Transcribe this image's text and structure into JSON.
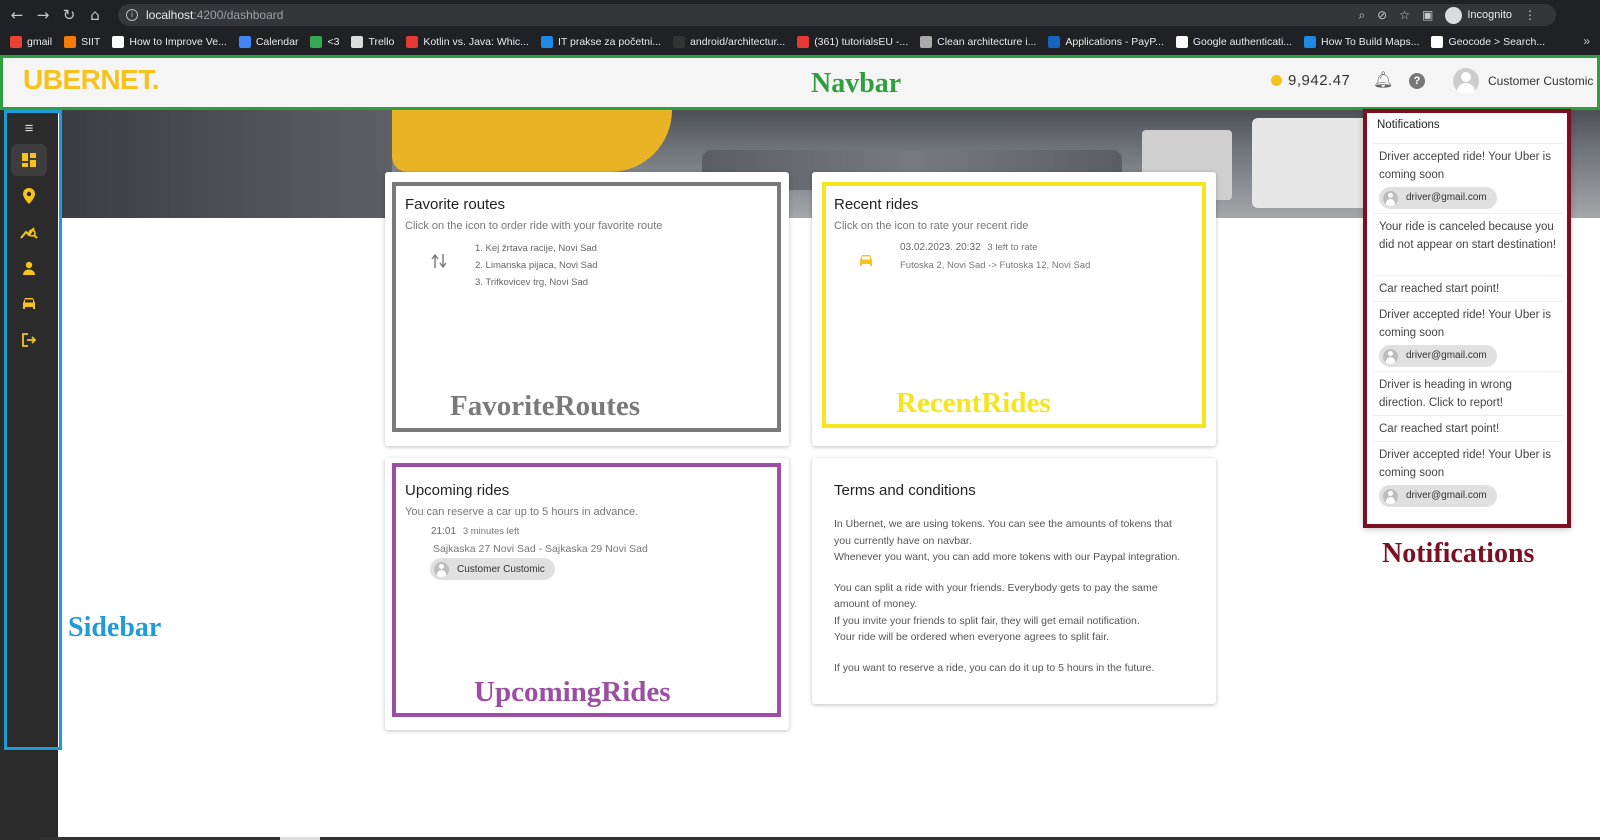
{
  "browser": {
    "url_host": "localhost",
    "url_path": ":4200/dashboard",
    "incognito_label": "Incognito",
    "bookmarks": [
      {
        "label": "gmail",
        "color": "#ea4335"
      },
      {
        "label": "SIIT",
        "color": "#f57c00"
      },
      {
        "label": "How to Improve Ve...",
        "color": "#ffffff"
      },
      {
        "label": "Calendar",
        "color": "#4285f4"
      },
      {
        "label": "<3",
        "color": "#34a853"
      },
      {
        "label": "Trello",
        "color": "#dddddd"
      },
      {
        "label": "Kotlin vs. Java: Whic...",
        "color": "#e53935"
      },
      {
        "label": "IT prakse za početni...",
        "color": "#1e88e5"
      },
      {
        "label": "android/architectur...",
        "color": "#333333"
      },
      {
        "label": "(361) tutorialsEU -...",
        "color": "#e53935"
      },
      {
        "label": "Clean architecture i...",
        "color": "#aaaaaa"
      },
      {
        "label": "Applications - PayP...",
        "color": "#1565c0"
      },
      {
        "label": "Google authenticati...",
        "color": "#ffffff"
      },
      {
        "label": "How To Build Maps...",
        "color": "#1e88e5"
      },
      {
        "label": "Geocode > Search...",
        "color": "#ffffff"
      }
    ]
  },
  "navbar": {
    "logo": "UBERNET",
    "logo_dot": ".",
    "tokens": "9,942.47",
    "user_name": "Customer Customic",
    "annotation": "Navbar",
    "annotation_color": "#2e9e3f"
  },
  "sidebar": {
    "annotation": "Sidebar",
    "items": [
      {
        "name": "menu-icon",
        "glyph": "≡"
      },
      {
        "name": "dashboard-icon",
        "glyph": "▦"
      },
      {
        "name": "location-pin-icon",
        "glyph": "⬤"
      },
      {
        "name": "route-search-icon",
        "glyph": "⌕"
      },
      {
        "name": "person-icon",
        "glyph": "●"
      },
      {
        "name": "car-icon",
        "glyph": "▬"
      },
      {
        "name": "logout-icon",
        "glyph": "⇥"
      }
    ]
  },
  "favorite_routes": {
    "title": "Favorite routes",
    "subtitle": "Click on the icon to order ride with your favorite route",
    "routes": [
      "1. Kej žrtava racije, Novi Sad",
      "2. Limanska pijaca, Novi Sad",
      "3. Trifkovicev trg, Novi Sad"
    ],
    "annotation": "FavoriteRoutes",
    "annotation_color": "#7a7a7a"
  },
  "recent_rides": {
    "title": "Recent rides",
    "subtitle": "Click on the icon to rate your recent ride",
    "ride_datetime": "03.02.2023. 20:32",
    "ride_rate_left": "3 left to rate",
    "ride_route": "Futoska 2, Novi Sad -> Futoska 12, Novi Sad",
    "annotation": "RecentRides",
    "annotation_color": "#f5e51c"
  },
  "upcoming_rides": {
    "title": "Upcoming rides",
    "subtitle": "You can reserve a car up to 5 hours in advance.",
    "time": "21:01",
    "time_left": "3 minutes left",
    "route": "Sajkaska 27 Novi Sad - Sajkaska 29 Novi Sad",
    "passenger": "Customer Customic",
    "annotation": "UpcomingRides",
    "annotation_color": "#9b4ea3"
  },
  "terms": {
    "title": "Terms and conditions",
    "paragraphs": [
      "In Ubernet, we are using tokens. You can see the amounts of tokens that",
      "you currently have on navbar.",
      "Whenever you want, you can add more tokens with our Paypal integration.",
      "",
      "You can split a ride with your friends. Everybody gets to pay the same",
      "amount of money.",
      "If you invite your friends to split fair, they will get email notification.",
      "Your ride will be ordered when everyone agrees to split fair.",
      "",
      "If you want to reserve a ride, you can do it up to 5 hours in the future."
    ]
  },
  "notifications": {
    "title": "Notifications",
    "annotation": "Notifications",
    "items": [
      {
        "text": "Driver accepted ride! Your Uber is coming soon",
        "chip": "driver@gmail.com"
      },
      {
        "text": "Your ride is canceled because you did not appear on start destination!",
        "chip": ""
      },
      {
        "text": "Car reached start point!",
        "chip": ""
      },
      {
        "text": "Driver accepted ride! Your Uber is coming soon",
        "chip": "driver@gmail.com"
      },
      {
        "text": "Driver is heading in wrong direction. Click to report!",
        "chip": ""
      },
      {
        "text": "Car reached start point!",
        "chip": ""
      },
      {
        "text": "Driver accepted ride! Your Uber is coming soon",
        "chip": "driver@gmail.com"
      }
    ]
  }
}
